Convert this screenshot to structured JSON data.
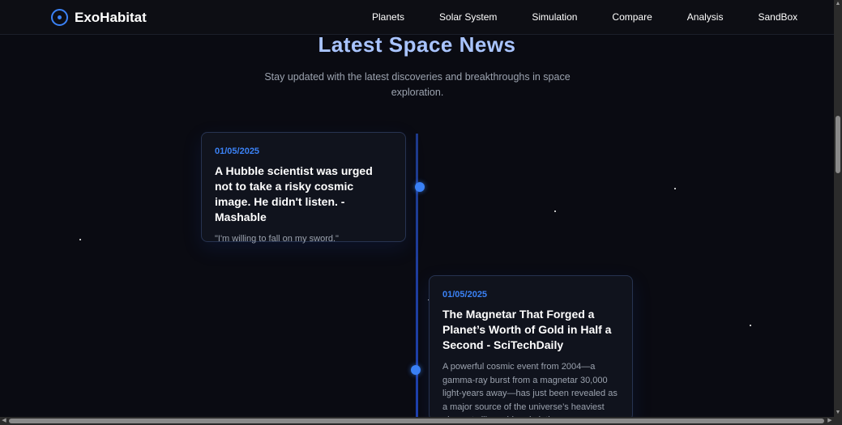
{
  "brand": {
    "name": "ExoHabitat",
    "logo_icon": "orbit-circle-icon",
    "accent": "#3b82f6"
  },
  "nav": {
    "links": [
      "Planets",
      "Solar System",
      "Simulation",
      "Compare",
      "Analysis",
      "SandBox"
    ]
  },
  "news": {
    "title": "Latest Space News",
    "subtitle": "Stay updated with the latest discoveries and breakthroughs in space exploration.",
    "items": [
      {
        "date": "01/05/2025",
        "title": "A Hubble scientist was urged not to take a risky cosmic image. He didn't listen. - Mashable",
        "excerpt": "\"I'm willing to fall on my sword.\""
      },
      {
        "date": "01/05/2025",
        "title": "The Magnetar That Forged a Planet’s Worth of Gold in Half a Second - SciTechDaily",
        "excerpt": "A powerful cosmic event from 2004—a gamma-ray burst from a magnetar 30,000 light-years away—has just been revealed as a major source of the universe’s heaviest elements like gold and platinum."
      }
    ]
  },
  "colors": {
    "background": "#0a0b12",
    "title": "#a9c4ff",
    "date": "#3b82f6"
  }
}
